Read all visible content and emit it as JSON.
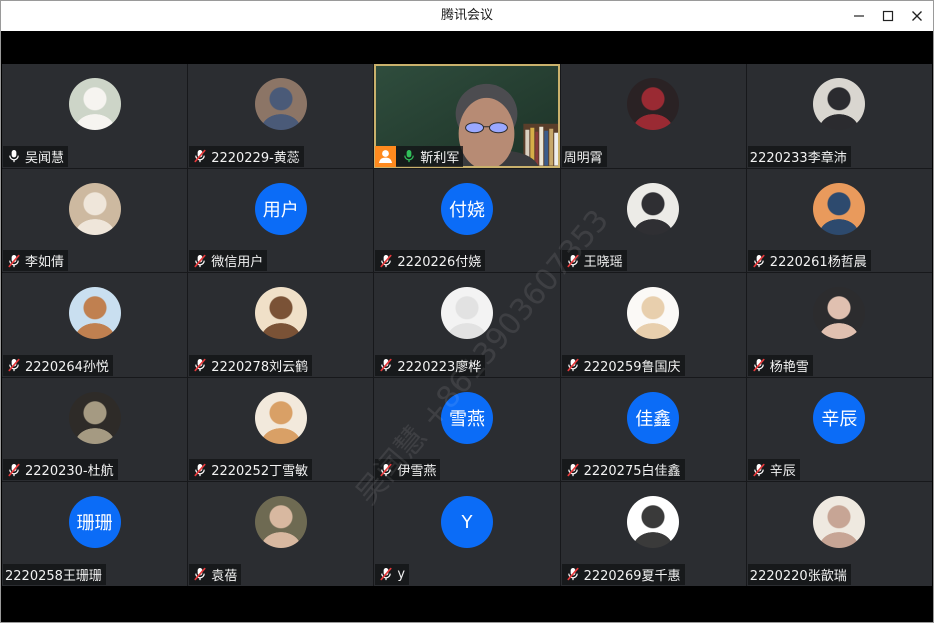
{
  "window": {
    "title": "腾讯会议",
    "controls": [
      "minimize-icon",
      "maximize-icon",
      "close-icon"
    ]
  },
  "colors": {
    "tile_background": "#2b2d31",
    "avatar_blue": "#0b6cf7",
    "mic_muted": "#e5393b",
    "mic_active": "#31c05a",
    "host_orange": "#ff8a1e",
    "speaking_border": "#c9b16c"
  },
  "watermark": "吴闻慧 +8613903607353",
  "participants": [
    {
      "name": "吴闻慧",
      "mic_icon": "mic-icon",
      "avatar": {
        "tones": [
          "#cdd5c8",
          "#f6f4f0"
        ]
      }
    },
    {
      "name": "2220229-黄蕊",
      "mic_icon": "mic-muted-icon",
      "avatar": {
        "tones": [
          "#8c7566",
          "#4a5a78"
        ]
      }
    },
    {
      "name": "靳利军",
      "mic_icon": "mic-active-icon",
      "host": true,
      "video": true
    },
    {
      "name": "周明霄",
      "mic_icon": null,
      "avatar": {
        "tones": [
          "#2a2224",
          "#9a2a33"
        ]
      }
    },
    {
      "name": "2220233李章沛",
      "mic_icon": null,
      "avatar": {
        "tones": [
          "#d9d6d0",
          "#2b2b2f"
        ]
      }
    },
    {
      "name": "李如倩",
      "mic_icon": "mic-muted-icon",
      "avatar": {
        "tones": [
          "#cdb9a0",
          "#efe6da"
        ]
      }
    },
    {
      "name": "微信用户",
      "mic_icon": "mic-muted-icon",
      "avatar": {
        "text": "用户"
      }
    },
    {
      "name": "2220226付娆",
      "mic_icon": "mic-muted-icon",
      "avatar": {
        "text": "付娆"
      }
    },
    {
      "name": "王晓瑶",
      "mic_icon": "mic-muted-icon",
      "avatar": {
        "tones": [
          "#ecebe7",
          "#2f2f33"
        ]
      }
    },
    {
      "name": "2220261杨哲晨",
      "mic_icon": "mic-muted-icon",
      "avatar": {
        "tones": [
          "#e99a5c",
          "#2d4a6e"
        ]
      }
    },
    {
      "name": "2220264孙悦",
      "mic_icon": "mic-muted-icon",
      "avatar": {
        "tones": [
          "#c9dff0",
          "#c08050"
        ]
      }
    },
    {
      "name": "2220278刘云鹤",
      "mic_icon": "mic-muted-icon",
      "avatar": {
        "tones": [
          "#f0e0c8",
          "#7a5236"
        ]
      }
    },
    {
      "name": "2220223廖桦",
      "mic_icon": "mic-muted-icon",
      "avatar": {
        "tones": [
          "#f3f3f3",
          "#e2e2e2"
        ]
      }
    },
    {
      "name": "2220259鲁国庆",
      "mic_icon": "mic-muted-icon",
      "avatar": {
        "tones": [
          "#fbf9f6",
          "#e8cfad"
        ]
      }
    },
    {
      "name": "杨艳雪",
      "mic_icon": "mic-muted-icon",
      "avatar": {
        "tones": [
          "#2c2c2e",
          "#e0c0b0"
        ]
      }
    },
    {
      "name": "2220230-杜航",
      "mic_icon": "mic-muted-icon",
      "avatar": {
        "tones": [
          "#2e2b28",
          "#a59a82"
        ]
      }
    },
    {
      "name": "2220252丁雪敏",
      "mic_icon": "mic-muted-icon",
      "avatar": {
        "tones": [
          "#f2e9dc",
          "#d9a066"
        ]
      }
    },
    {
      "name": "伊雪燕",
      "mic_icon": "mic-muted-icon",
      "avatar": {
        "text": "雪燕"
      }
    },
    {
      "name": "2220275白佳鑫",
      "mic_icon": "mic-muted-icon",
      "avatar": {
        "text": "佳鑫"
      }
    },
    {
      "name": "辛辰",
      "mic_icon": "mic-muted-icon",
      "avatar": {
        "text": "辛辰"
      }
    },
    {
      "name": "2220258王珊珊",
      "mic_icon": null,
      "avatar": {
        "text": "珊珊"
      }
    },
    {
      "name": "袁蓓",
      "mic_icon": "mic-muted-icon",
      "avatar": {
        "tones": [
          "#6e6a52",
          "#d8b8a0"
        ]
      }
    },
    {
      "name": "y",
      "mic_icon": "mic-muted-icon",
      "avatar": {
        "text": "Y"
      }
    },
    {
      "name": "2220269夏千惠",
      "mic_icon": "mic-muted-icon",
      "avatar": {
        "tones": [
          "#ffffff",
          "#3a3a3a"
        ]
      }
    },
    {
      "name": "2220220张歆瑞",
      "mic_icon": null,
      "avatar": {
        "tones": [
          "#efe9e0",
          "#c7a595"
        ]
      }
    }
  ]
}
